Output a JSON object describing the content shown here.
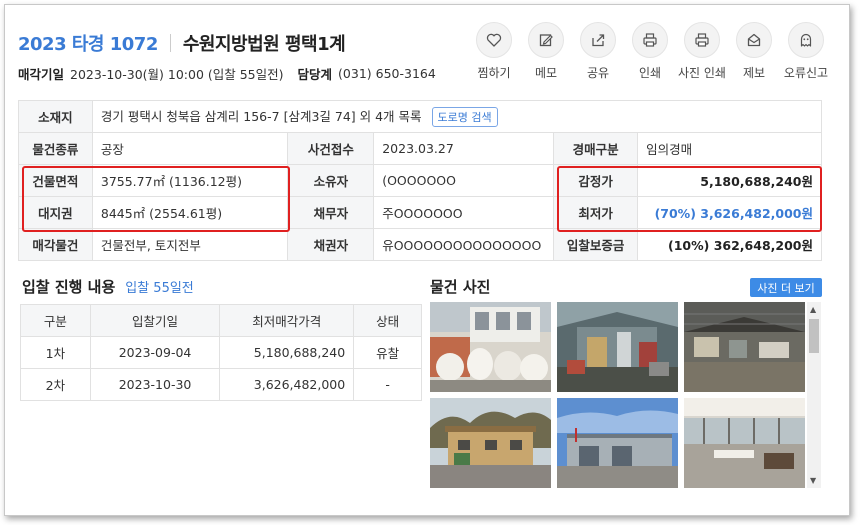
{
  "header": {
    "case_no": "2023 타경 1072",
    "court": "수원지방법원 평택1계",
    "sale_date_label": "매각기일",
    "sale_date_value": "2023-10-30(월) 10:00 (입찰 55일전)",
    "manager_label": "담당계",
    "manager_value": "(031) 650-3164"
  },
  "actions": [
    {
      "label": "찜하기",
      "icon": "heart-icon"
    },
    {
      "label": "메모",
      "icon": "memo-icon"
    },
    {
      "label": "공유",
      "icon": "share-icon"
    },
    {
      "label": "인쇄",
      "icon": "print-icon"
    },
    {
      "label": "사진 인쇄",
      "icon": "photo-print-icon"
    },
    {
      "label": "제보",
      "icon": "report-icon"
    },
    {
      "label": "오류신고",
      "icon": "error-report-icon"
    }
  ],
  "info": {
    "location_label": "소재지",
    "location_value": "경기 평택시 청북읍 삼계리 156-7 [삼계3길 74] 외 4개 목록",
    "road_search": "도로명 검색",
    "type_label": "물건종류",
    "type_value": "공장",
    "filed_label": "사건접수",
    "filed_value": "2023.03.27",
    "auction_type_label": "경매구분",
    "auction_type_value": "임의경매",
    "building_area_label": "건물면적",
    "building_area_value": "3755.77㎡ (1136.12평)",
    "owner_label": "소유자",
    "owner_value": "(OOOOOOO",
    "appraisal_label": "감정가",
    "appraisal_value": "5,180,688,240원",
    "land_label": "대지권",
    "land_value": "8445㎡ (2554.61평)",
    "debtor_label": "채무자",
    "debtor_value": "주OOOOOOO",
    "min_price_label": "최저가",
    "min_price_value": "(70%) 3,626,482,000원",
    "sale_object_label": "매각물건",
    "sale_object_value": "건물전부, 토지전부",
    "creditor_label": "채권자",
    "creditor_value": "유OOOOOOOOOOOOOOO",
    "deposit_label": "입찰보증금",
    "deposit_value": "(10%) 362,648,200원"
  },
  "bids": {
    "title": "입찰 진행 내용",
    "note": "입찰 55일전",
    "headers": [
      "구분",
      "입찰기일",
      "최저매각가격",
      "상태"
    ],
    "rows": [
      [
        "1차",
        "2023-09-04",
        "5,180,688,240",
        "유찰"
      ],
      [
        "2차",
        "2023-10-30",
        "3,626,482,000",
        "-"
      ]
    ]
  },
  "photos": {
    "title": "물건 사진",
    "more_button": "사진 더 보기"
  }
}
